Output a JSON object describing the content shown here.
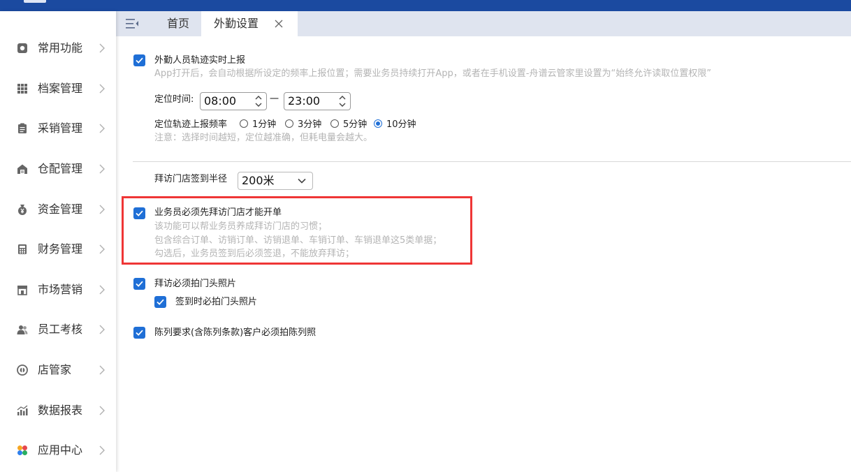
{
  "tabs": {
    "home_label": "首页",
    "active_label": "外勤设置"
  },
  "sidebar": {
    "items": [
      {
        "label": "常用功能",
        "icon": "target-icon"
      },
      {
        "label": "档案管理",
        "icon": "grid-icon"
      },
      {
        "label": "采销管理",
        "icon": "clipboard-icon"
      },
      {
        "label": "仓配管理",
        "icon": "warehouse-icon"
      },
      {
        "label": "资金管理",
        "icon": "money-bag-icon"
      },
      {
        "label": "财务管理",
        "icon": "calculator-icon"
      },
      {
        "label": "市场营销",
        "icon": "store-icon"
      },
      {
        "label": "员工考核",
        "icon": "people-icon"
      },
      {
        "label": "店管家",
        "icon": "shop-manager-icon"
      },
      {
        "label": "数据报表",
        "icon": "bar-chart-icon"
      },
      {
        "label": "应用中心",
        "icon": "apps-icon"
      }
    ]
  },
  "settings": {
    "track_report": {
      "label": "外勤人员轨迹实时上报",
      "checked": true,
      "hint": "App打开后，会自动根据所设定的频率上报位置；需要业务员持续打开App，或者在手机设置-舟谱云管家里设置为“始终允许读取位置权限”"
    },
    "locate_time": {
      "label": "定位时间:",
      "start": "08:00",
      "separator": "一",
      "end": "23:00"
    },
    "frequency": {
      "label": "定位轨迹上报频率",
      "options": [
        "1分钟",
        "3分钟",
        "5分钟",
        "10分钟"
      ],
      "selected": "10分钟",
      "note": "注意：选择时间越短，定位越准确，但耗电量会越大。"
    },
    "radius": {
      "label": "拜访门店签到半径",
      "value": "200米"
    },
    "must_visit": {
      "label": "业务员必须先拜访门店才能开单",
      "checked": true,
      "hints": [
        "该功能可以帮业务员养成拜访门店的习惯；",
        "包含综合订单、访销订单、访销退单、车销订单、车销退单这5类单据；",
        "勾选后，业务员签到后必须签退，不能放弃拜访；"
      ]
    },
    "door_photo": {
      "label": "拜访必须拍门头照片",
      "checked": true,
      "sub_label": "签到时必拍门头照片",
      "sub_checked": true
    },
    "display_photo": {
      "label": "陈列要求(含陈列条款)客户必须拍陈列照",
      "checked": true
    }
  },
  "colors": {
    "topbar": "#1b4aa0",
    "accent": "#1f6fd6",
    "highlight_box": "#ef3636",
    "hint_text": "#b4b4b4"
  }
}
